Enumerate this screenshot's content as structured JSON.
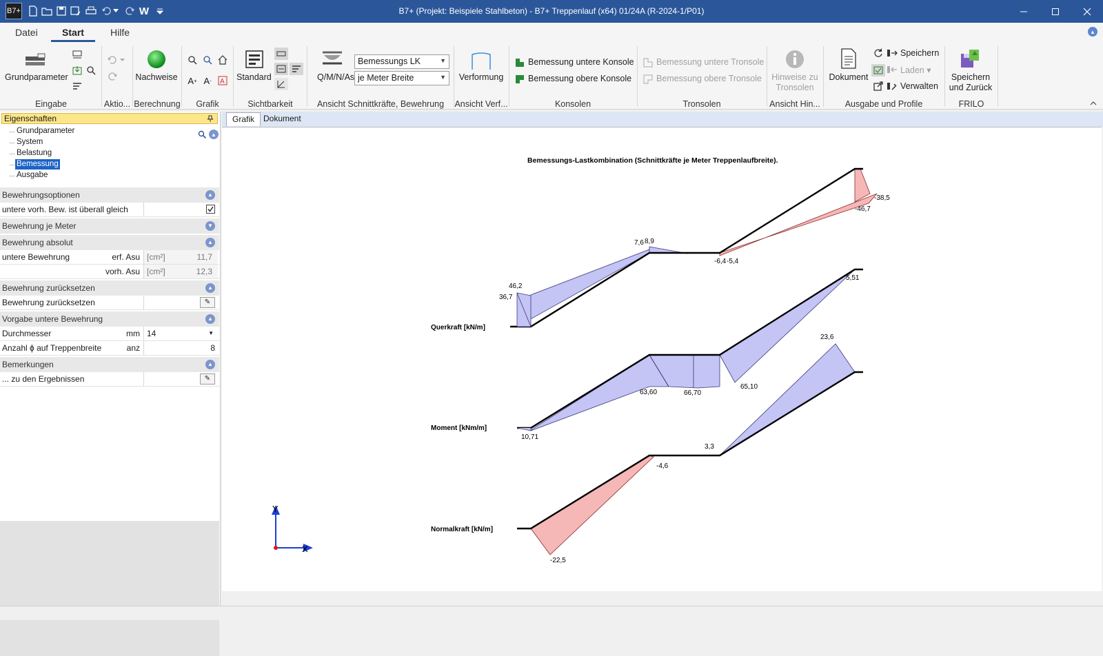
{
  "titlebar": {
    "logo": "B7+",
    "title": "B7+ (Projekt: Beispiele Stahlbeton) - B7+ Treppenlauf (x64) 01/24A (R-2024-1/P01)",
    "quick_access": [
      "new-file-icon",
      "open-folder-icon",
      "save-icon",
      "save-as-icon",
      "print-icon",
      "undo-icon",
      "undo-dropdown-icon",
      "redo-icon",
      "word-icon",
      "customize-icon"
    ],
    "word_label": "W"
  },
  "menu": {
    "tabs": [
      "Datei",
      "Start",
      "Hilfe"
    ],
    "active": "Start"
  },
  "ribbon": {
    "eingabe": {
      "label": "Eingabe",
      "grundparameter": "Grundparameter"
    },
    "aktionen": {
      "label": "Aktio..."
    },
    "berechnung": {
      "label": "Berechnung",
      "nachweise": "Nachweise"
    },
    "grafik": {
      "label": "Grafik"
    },
    "sichtbarkeit": {
      "label": "Sichtbarkeit",
      "standard": "Standard"
    },
    "ansicht_schnittkraefte": {
      "label": "Ansicht Schnittkräfte, Bewehrung",
      "qmnas": "Q/M/N/As",
      "combo1": "Bemessungs LK",
      "combo2": "je Meter Breite"
    },
    "ansicht_verformung": {
      "label": "Ansicht Verf...",
      "verformung": "Verformung"
    },
    "konsolen": {
      "label": "Konsolen",
      "untere": "Bemessung untere Konsole",
      "obere": "Bemessung obere Konsole"
    },
    "tronsolen": {
      "label": "Tronsolen",
      "untere": "Bemessung untere Tronsole",
      "obere": "Bemessung obere Tronsole"
    },
    "ansicht_hinweise": {
      "label": "Ansicht Hin...",
      "hinweise_line1": "Hinweise zu",
      "hinweise_line2": "Tronsolen"
    },
    "ausgabe": {
      "label": "Ausgabe und Profile",
      "dokument": "Dokument",
      "speichern": "Speichern",
      "laden": "Laden",
      "verwalten": "Verwalten"
    },
    "frilo": {
      "label": "FRILO",
      "line1": "Speichern",
      "line2": "und Zurück"
    }
  },
  "properties": {
    "header": "Eigenschaften",
    "tree": [
      "Grundparameter",
      "System",
      "Belastung",
      "Bemessung",
      "Ausgabe"
    ],
    "tree_selected": "Bemessung",
    "sections": {
      "bewehrungsoptionen": "Bewehrungsoptionen",
      "bewehrung_je_meter": "Bewehrung je Meter",
      "bewehrung_absolut": "Bewehrung absolut",
      "bewehrung_zuruecksetzen": "Bewehrung zurücksetzen",
      "vorgabe_untere": "Vorgabe untere Bewehrung",
      "bemerkungen": "Bemerkungen"
    },
    "rows": {
      "gleich": {
        "label": "untere vorh. Bew. ist überall gleich",
        "checked": true
      },
      "untere_bew": {
        "label": "untere Bewehrung",
        "unit": "erf. Asu",
        "unit2": "[cm²]",
        "value": "11,7"
      },
      "vorh_asu": {
        "unit": "vorh. Asu",
        "unit2": "[cm²]",
        "value": "12,3"
      },
      "zuruecksetzen": {
        "label": "Bewehrung zurücksetzen"
      },
      "durchmesser": {
        "label": "Durchmesser",
        "unit": "mm",
        "value": "14"
      },
      "anzahl": {
        "label": "Anzahl ϕ auf Treppenbreite",
        "unit": "anz",
        "value": "8"
      },
      "ergebnisse": {
        "label": "... zu den Ergebnissen"
      }
    }
  },
  "doc_tabs": [
    "Grafik",
    "Dokument"
  ],
  "doc_tab_active": "Grafik",
  "diagram": {
    "title": "Bemessungs-Lastkombination (Schnittkräfte je Meter Treppenlaufbreite).",
    "axis_x": "X",
    "axis_y": "Y",
    "querkraft": {
      "label": "Querkraft [kN/m]",
      "values": [
        "46,2",
        "36,7",
        "7,6",
        "8,9",
        "-6,4",
        "-5,4",
        "-46,7",
        "-38,5"
      ]
    },
    "moment": {
      "label": "Moment [kNm/m]",
      "values": [
        "5,51",
        "63,60",
        "66,70",
        "65,10",
        "10,71"
      ]
    },
    "normalkraft": {
      "label": "Normalkraft [kN/m]",
      "values": [
        "23,6",
        "3,3",
        "-4,6",
        "-22,5"
      ]
    },
    "colors": {
      "positive": "#c4c4f5",
      "negative": "#f6b7b7",
      "outline": "#3a3a7a",
      "neg_outline": "#8a2a2a"
    }
  }
}
